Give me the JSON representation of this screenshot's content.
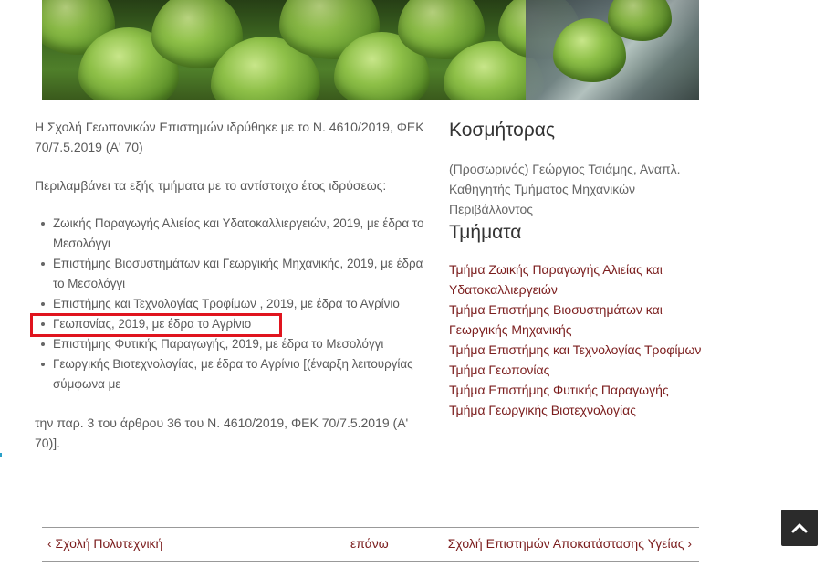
{
  "intro_text": "Η Σχολή Γεωπονικών Επιστημών ιδρύθηκε με το Ν. 4610/2019, ΦΕΚ 70/7.5.2019 (Α' 70)",
  "lead_text": "Περιλαμβάνει τα εξής τμήματα με το αντίστοιχο έτος ιδρύσεως:",
  "departments": [
    "Ζωικής Παραγωγής Αλιείας και Υδατοκαλλιεργειών, 2019, με έδρα το Μεσολόγγι",
    "Επιστήμης Βιοσυστημάτων και Γεωργικής Μηχανικής, 2019, με έδρα το Μεσολόγγι",
    "Επιστήμης και Τεχνολογίας Τροφίμων , 2019, με έδρα το Αγρίνιο",
    "Γεωπονίας, 2019, με έδρα το Αγρίνιο",
    "Επιστήμης Φυτικής Παραγωγής, 2019, με έδρα το Μεσολόγγι",
    "Γεωργικής Βιοτεχνολογίας, με έδρα το Αγρίνιο [(έναρξη λειτουργίας σύμφωνα με"
  ],
  "closing_text": "την παρ. 3 του άρθρου 36 του Ν. 4610/2019, ΦΕΚ 70/7.5.2019 (Α' 70)].",
  "sidebar": {
    "dean_heading": "Κοσμήτορας",
    "dean_text": "(Προσωρινός) Γεώργιος Τσιάμης, Αναπλ. Καθηγητής Τμήματος Μηχανικών Περιβάλλοντος",
    "departments_heading": "Τμήματα",
    "links": [
      "Τμήμα Ζωικής Παραγωγής Αλιείας και Υδατοκαλλιεργειών",
      "Τμήμα Επιστήμης Βιοσυστημάτων και Γεωργικής Μηχανικής",
      "Τμήμα Επιστήμης και Τεχνολογίας Τροφίμων",
      "Τμήμα Γεωπονίας",
      "Τμήμα Επιστήμης Φυτικής Παραγωγής",
      "Τμήμα Γεωργικής Βιοτεχνολογίας"
    ]
  },
  "nav": {
    "prev": "‹ Σχολή Πολυτεχνική",
    "top": "επάνω",
    "next": "Σχολή Επιστημών Αποκατάστασης Υγείας ›"
  },
  "colors": {
    "link": "#7b1d1d",
    "highlight": "#e0141e",
    "scroll_button": "#2b2b2b"
  },
  "icons": {
    "scroll_top": "chevron-up-icon"
  }
}
